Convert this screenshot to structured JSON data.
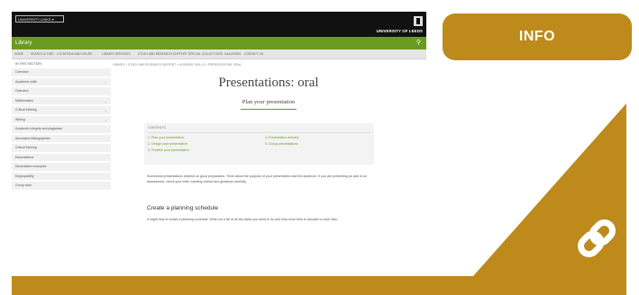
{
  "screenshot": {
    "uni_button": "UNIVERSITY LINKS ▾",
    "uni_name": "UNIVERSITY OF LEEDS",
    "section_title": "Library",
    "nav": [
      "HOME",
      "SEARCH & FIND",
      "LOCATIONS AND HOURS",
      "LIBRARY SERVICES",
      "STUDY AND RESEARCH SUPPORT",
      "SPECIAL COLLECTIONS",
      "GALLERIES",
      "CONTACT US"
    ],
    "sidebar_heading": "IN THIS SECTION",
    "sidebar_items": [
      {
        "label": "Overview",
        "expandable": false
      },
      {
        "label": "Academic skills",
        "expandable": true
      },
      {
        "label": "Overview",
        "expandable": false
      },
      {
        "label": "Mathematics",
        "expandable": true
      },
      {
        "label": "Critical thinking",
        "expandable": true
      },
      {
        "label": "Writing",
        "expandable": true
      },
      {
        "label": "Academic integrity and plagiarism",
        "expandable": false
      },
      {
        "label": "Annotated bibliographies",
        "expandable": false
      },
      {
        "label": "Critical thinking",
        "expandable": false
      },
      {
        "label": "Dissertations",
        "expandable": false
      },
      {
        "label": "Dissertation examples",
        "expandable": false
      },
      {
        "label": "Employability",
        "expandable": false
      },
      {
        "label": "Group work",
        "expandable": false
      }
    ],
    "breadcrumb": "LIBRARY > STUDY AND RESEARCH SUPPORT > ACADEMIC SKILLS > PRESENTATIONS: ORAL",
    "page_title": "Presentations: oral",
    "page_subtitle": "Plan your presentation",
    "contents_heading": "CONTENTS",
    "contents_links": [
      "1. Plan your presentation",
      "2. Design your presentation",
      "3. Practise your presentation",
      "4. Presentation delivery",
      "5. Group presentations"
    ],
    "body_paragraph": "Successful presentations depend on good preparation. Think about the purpose of your presentation and the audience. If you are presenting as part of an assessment, check your brief, marking criteria and guidance carefully.",
    "section_heading": "Create a planning schedule",
    "section_paragraph": "It might help to create a planning schedule. Write out a list of all the tasks you need to do and how much time to allocate to each task."
  },
  "info_button": "INFO",
  "colors": {
    "accent_gold": "#bd8a1b",
    "leeds_green": "#6a9a1f",
    "header_black": "#111111"
  },
  "icons": {
    "corner": "link-icon"
  }
}
